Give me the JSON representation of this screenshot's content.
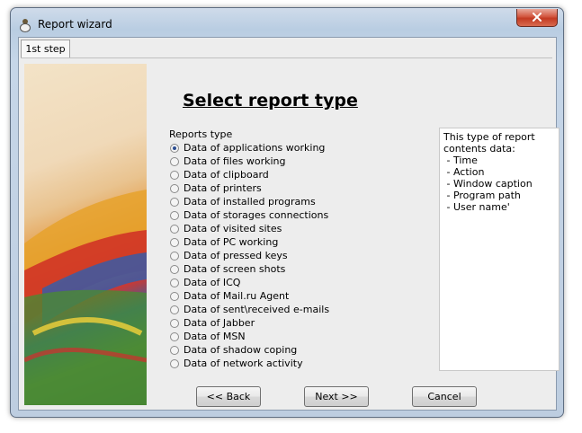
{
  "window": {
    "title": "Report wizard"
  },
  "tab": {
    "label": "1st step"
  },
  "heading": "Select report type",
  "reports": {
    "group_label": "Reports type",
    "selected_index": 0,
    "options": [
      "Data of applications working",
      "Data of files working",
      "Data of clipboard",
      "Data of printers",
      "Data of installed programs",
      "Data of storages connections",
      "Data of visited sites",
      "Data of PC working",
      "Data of pressed keys",
      "Data of screen shots",
      "Data of ICQ",
      "Data of Mail.ru Agent",
      "Data of sent\\received e-mails",
      "Data of Jabber",
      "Data of MSN",
      "Data of shadow coping",
      "Data of network activity"
    ]
  },
  "description": {
    "lines": [
      "This type of report",
      "contents data:",
      " - Time",
      " - Action",
      " - Window caption",
      " - Program path",
      " - User name'"
    ]
  },
  "buttons": {
    "back": "<< Back",
    "next": "Next >>",
    "cancel": "Cancel"
  },
  "icons": {
    "app": "app-icon",
    "close": "close-icon"
  },
  "colors": {
    "accent_close": "#c33a22",
    "radio_selected": "#2b4d91"
  }
}
